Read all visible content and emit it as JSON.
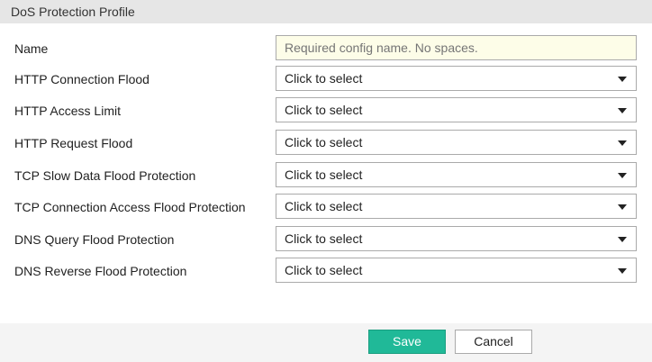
{
  "header": {
    "title": "DoS Protection Profile"
  },
  "name_field": {
    "label": "Name",
    "placeholder": "Required config name. No spaces."
  },
  "selects": [
    {
      "label": "HTTP Connection Flood",
      "value": "Click to select"
    },
    {
      "label": "HTTP Access Limit",
      "value": "Click to select"
    },
    {
      "label": "HTTP Request Flood",
      "value": "Click to select"
    },
    {
      "label": "TCP Slow Data Flood Protection",
      "value": "Click to select"
    },
    {
      "label": "TCP Connection Access Flood Protection",
      "value": "Click to select"
    },
    {
      "label": "DNS Query Flood Protection",
      "value": "Click to select"
    },
    {
      "label": "DNS Reverse Flood Protection",
      "value": "Click to select"
    }
  ],
  "footer": {
    "save": "Save",
    "cancel": "Cancel"
  },
  "colors": {
    "accent": "#20b998",
    "header_bg": "#e6e6e6",
    "name_bg": "#fdfde8"
  }
}
